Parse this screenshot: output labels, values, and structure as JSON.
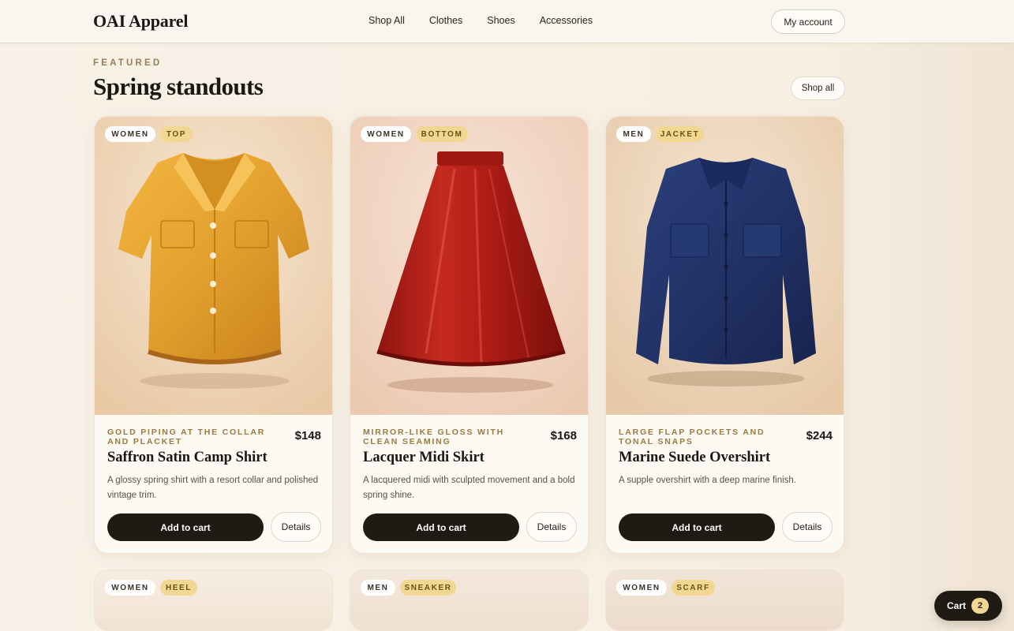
{
  "brand": "OAI Apparel",
  "nav": [
    "Shop All",
    "Clothes",
    "Shoes",
    "Accessories"
  ],
  "account_label": "My account",
  "section": {
    "eyebrow": "FEATURED",
    "title": "Spring standouts",
    "shop_all_label": "Shop all"
  },
  "products": [
    {
      "gender": "WOMEN",
      "kind": "TOP",
      "feature": "Gold piping at the collar and placket",
      "price": "$148",
      "name": "Saffron Satin Camp Shirt",
      "description": "A glossy spring shirt with a resort collar and polished vintage trim.",
      "add_label": "Add to cart",
      "details_label": "Details"
    },
    {
      "gender": "WOMEN",
      "kind": "BOTTOM",
      "feature": "Mirror-like gloss with clean seaming",
      "price": "$168",
      "name": "Lacquer Midi Skirt",
      "description": "A lacquered midi with sculpted movement and a bold spring shine.",
      "add_label": "Add to cart",
      "details_label": "Details"
    },
    {
      "gender": "MEN",
      "kind": "JACKET",
      "feature": "Large flap pockets and tonal snaps",
      "price": "$244",
      "name": "Marine Suede Overshirt",
      "description": "A supple overshirt with a deep marine finish.",
      "add_label": "Add to cart",
      "details_label": "Details"
    }
  ],
  "next_row": [
    {
      "gender": "WOMEN",
      "kind": "HEEL"
    },
    {
      "gender": "MEN",
      "kind": "SNEAKER"
    },
    {
      "gender": "WOMEN",
      "kind": "SCARF"
    }
  ],
  "cart": {
    "label": "Cart",
    "count": "2"
  },
  "colors": {
    "background": "#f7f0e6",
    "accent_dark": "#1f1a13",
    "tag_gold": "#f2d792",
    "feature_gold": "#9a7a3f"
  }
}
